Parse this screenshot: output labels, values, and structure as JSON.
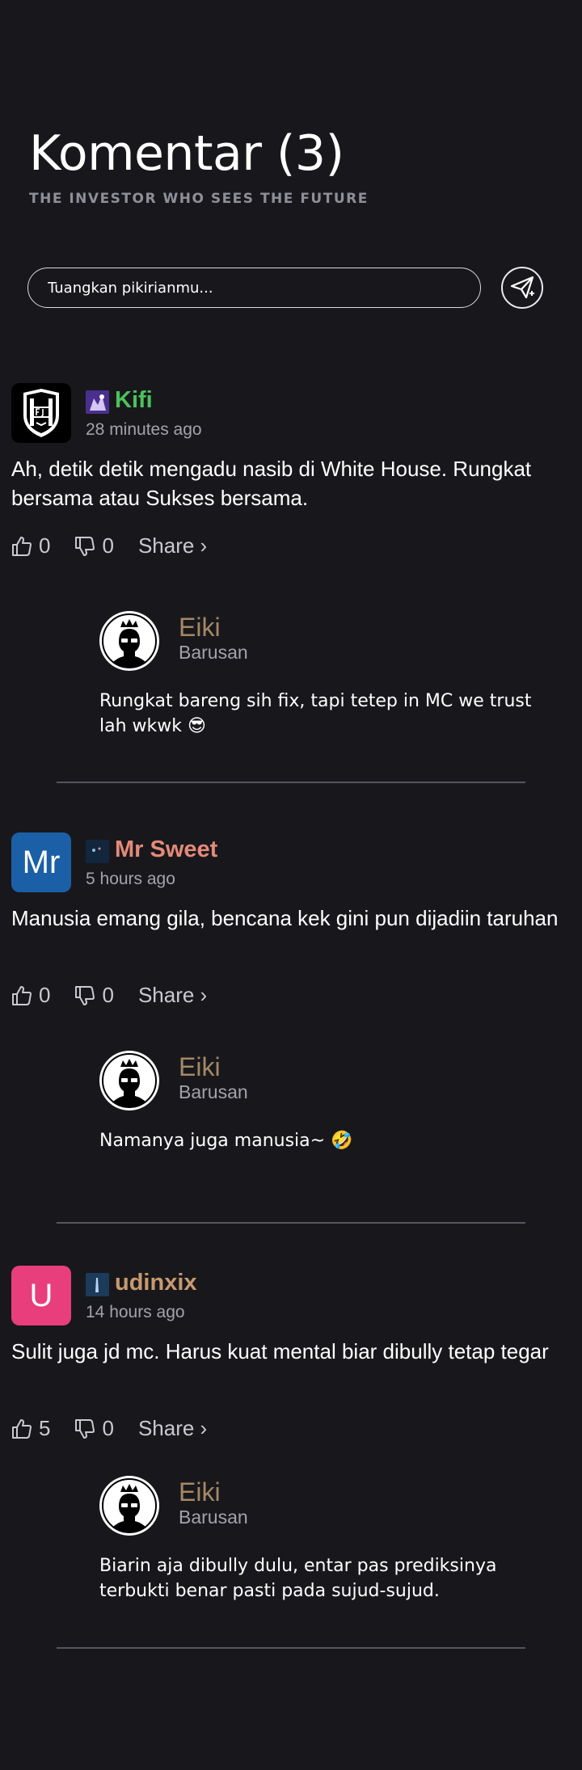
{
  "header": {
    "title": "Komentar (3)",
    "subtitle": "THE INVESTOR WHO SEES THE FUTURE"
  },
  "input": {
    "placeholder": "Tuangkan pikirianmu..."
  },
  "send_icon": "paper-plane-icon",
  "comments": [
    {
      "author": "Kifi",
      "author_color": "#4dc15b",
      "avatar": "fjm-shield-logo",
      "time": "28 minutes ago",
      "text": "Ah, detik detik mengadu nasib di White House. Rungkat bersama atau Sukses bersama.",
      "likes": "0",
      "dislikes": "0",
      "share": "Share ›",
      "reply": {
        "author": "Eiki",
        "time": "Barusan",
        "text": "Rungkat bareng sih fix, tapi tetep in MC we trust lah wkwk 😎"
      }
    },
    {
      "author": "Mr Sweet",
      "author_color": "#e48a78",
      "avatar": "Mr",
      "avatar_color": "#1b5fa6",
      "time": "5 hours ago",
      "text": "Manusia emang gila, bencana kek gini pun dijadiin taruhan",
      "likes": "0",
      "dislikes": "0",
      "share": "Share ›",
      "reply": {
        "author": "Eiki",
        "time": "Barusan",
        "text": "Namanya juga manusia~ 🤣"
      }
    },
    {
      "author": "udinxix",
      "author_color": "#c79a6e",
      "avatar": "U",
      "avatar_color": "#e83e7c",
      "time": "14 hours ago",
      "text": "Sulit juga jd mc. Harus kuat mental biar dibully tetap tegar",
      "likes": "5",
      "dislikes": "0",
      "share": "Share ›",
      "reply": {
        "author": "Eiki",
        "time": "Barusan",
        "text": "Biarin aja dibully dulu, entar pas prediksinya terbukti benar pasti pada sujud-sujud."
      }
    }
  ]
}
